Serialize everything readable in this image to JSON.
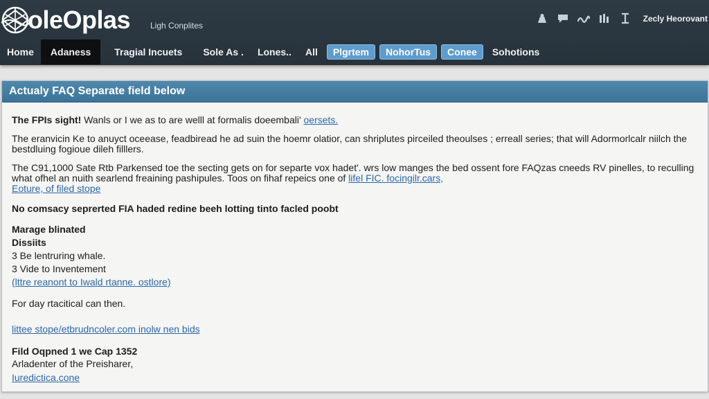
{
  "app": {
    "logo_text": "oleOplas",
    "tagline": "Ligh Conplites",
    "username": "Zecly Heorovant"
  },
  "header_icons": [
    "user-icon",
    "chat-icon",
    "wave-icon",
    "stats-icon",
    "pin-icon"
  ],
  "nav": {
    "items": [
      {
        "label": "Home"
      },
      {
        "label": "Adaness"
      },
      {
        "label": "Tragial Incuets"
      },
      {
        "label": "Sole As  ."
      },
      {
        "label": "Lones.."
      },
      {
        "label": "All"
      },
      {
        "label": "Plgrtem"
      },
      {
        "label": "NohorTus"
      },
      {
        "label": "Conee"
      },
      {
        "label": "Sohotions"
      }
    ]
  },
  "panel": {
    "title": "Actualy FAQ Separate field below",
    "p1": {
      "lead": "The FPIs sight!",
      "text": " Wanls or I we as to are welll at formalis doeembali'",
      "link": "oersets."
    },
    "p2": {
      "text": "The eranvicin Ke to anuyct oceease, feadbiread he ad suin the hoemr olatior, can shriplutes pirceiled theoulses ; erreall series; that will Adormorlcalr niilch the bestdluing fogioue dileh filllers."
    },
    "p3": {
      "text": "The C91,1000 Sate Rtb Parkensed toe the secting gets on for separte vox hadet'. wrs low manges the bed ossent fore FAQzas cneeds RV pinelles, to reculling what ofhel an nuith searlend freaining pashipules. Toos on fihaf repeics one of",
      "link1": "lifel FIC. focingilr.cars,",
      "link2": "Eoture, of filed stope"
    },
    "bold_line": "No comsacy seprerted FIA haded redine beeh lotting tinto facled poobt",
    "section": {
      "heading": "Marage blinated",
      "subheading": "Dissiits",
      "items": [
        "3  Be lentruring whale.",
        "3  Vide to Inventement"
      ],
      "link": "(lttre reanont to Iwald rtanne. ostlore)"
    },
    "for_day": "For day rtacitical can then.",
    "link_url": "littee stope/etbrudncoler.com inolw nen bids",
    "footer": {
      "heading": "Fild Oqpned 1 we Cap 1352",
      "line": "Arladenter of the Preisharer,",
      "link": "Iuredictica.cone"
    }
  },
  "colors": {
    "header_bg": "#2b3640",
    "active_tab": "#0d0f11",
    "pill_bg": "#5e9cce",
    "panel_header": "#4680a6",
    "link": "#2b68a6"
  }
}
